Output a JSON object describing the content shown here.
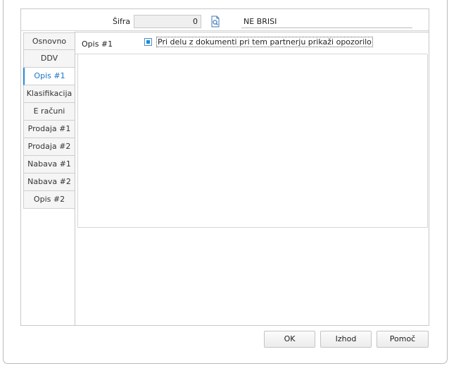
{
  "header": {
    "sifra_label": "Šifra",
    "sifra_value": "0",
    "lookup_icon": "document-search-icon",
    "ne_brisi_label": "NE BRISI"
  },
  "tabs": [
    {
      "label": "Osnovno",
      "active": false
    },
    {
      "label": "DDV",
      "active": false
    },
    {
      "label": "Opis #1",
      "active": true
    },
    {
      "label": "Klasifikacija",
      "active": false
    },
    {
      "label": "E računi",
      "active": false
    },
    {
      "label": "Prodaja #1",
      "active": false
    },
    {
      "label": "Prodaja #2",
      "active": false
    },
    {
      "label": "Nabava #1",
      "active": false
    },
    {
      "label": "Nabava #2",
      "active": false
    },
    {
      "label": "Opis #2",
      "active": false
    }
  ],
  "content": {
    "section_label": "Opis #1",
    "warning_checkbox": {
      "label": "Pri delu z dokumenti pri tem partnerju prikaži opozorilo",
      "checked": true
    },
    "memo_text": ""
  },
  "footer": {
    "ok_label": "OK",
    "izhod_label": "Izhod",
    "pomoc_label": "Pomoč"
  },
  "colors": {
    "accent": "#2a8ad4",
    "active_tab_text": "#1a73c9"
  }
}
